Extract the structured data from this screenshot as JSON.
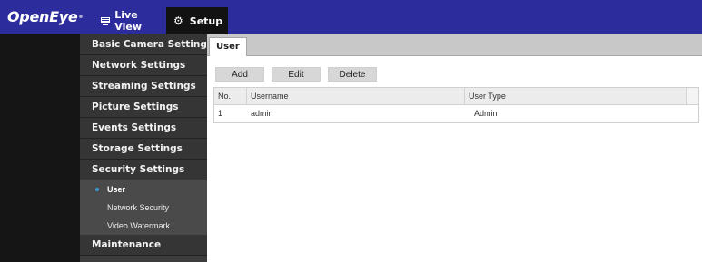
{
  "app": {
    "logo": "OpenEye",
    "logo_mark": "®"
  },
  "nav": {
    "tabs": [
      {
        "label": "Live View",
        "icon": "monitor-icon"
      },
      {
        "label": "Setup",
        "icon": "gear-icon",
        "active": true
      }
    ]
  },
  "sidebar": {
    "items": [
      {
        "label": "Basic Camera Settings"
      },
      {
        "label": "Network Settings"
      },
      {
        "label": "Streaming Settings"
      },
      {
        "label": "Picture Settings"
      },
      {
        "label": "Events Settings"
      },
      {
        "label": "Storage Settings"
      },
      {
        "label": "Security Settings",
        "expanded": true,
        "children": [
          {
            "label": "User",
            "active": true
          },
          {
            "label": "Network Security"
          },
          {
            "label": "Video Watermark"
          }
        ]
      },
      {
        "label": "Maintenance"
      }
    ]
  },
  "main": {
    "tab": "User",
    "buttons": {
      "add": "Add",
      "edit": "Edit",
      "delete": "Delete"
    },
    "table": {
      "columns": [
        "No.",
        "Username",
        "User Type"
      ],
      "rows": [
        [
          "1",
          "admin",
          "Admin"
        ]
      ]
    }
  },
  "colors": {
    "topbar": "#2d2c9c",
    "setup_tab": "#121212",
    "sidebar": "#3c3c3c",
    "active_dot": "#3a9ad9"
  }
}
